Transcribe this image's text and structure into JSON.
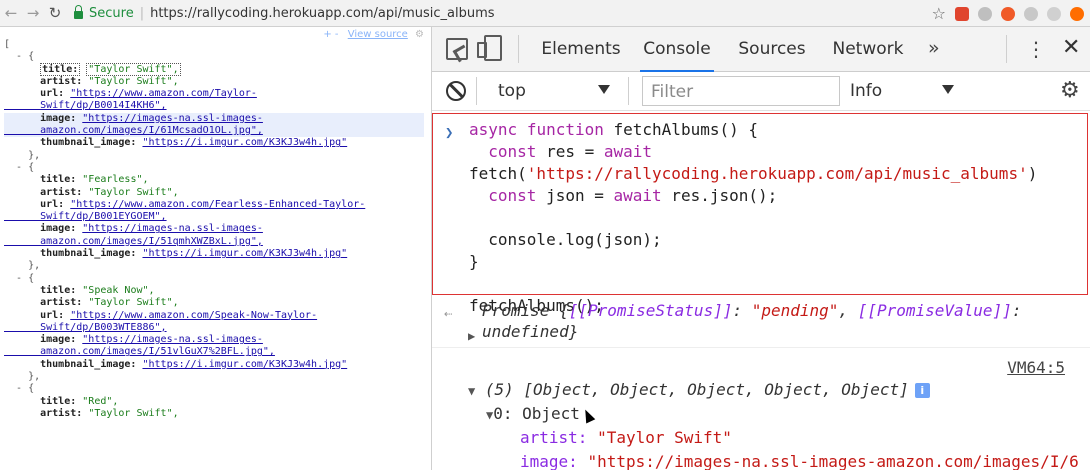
{
  "browser": {
    "secure_label": "Secure",
    "url": "https://rallycoding.herokuapp.com/api/music_albums"
  },
  "json_view": {
    "toolbar_plusminus": "+ -",
    "view_source": "View source",
    "lines": [
      "[",
      "  - {",
      "      title: \"Taylor Swift\",",
      "      artist: \"Taylor Swift\",",
      "      url: \"https://www.amazon.com/Taylor-",
      "      Swift/dp/B0014I4KH6\",",
      "      image: \"https://images-na.ssl-images-",
      "      amazon.com/images/I/61McsadO1OL.jpg\",",
      "      thumbnail_image: \"https://i.imgur.com/K3KJ3w4h.jpg\"",
      "    },",
      "  - {",
      "      title: \"Fearless\",",
      "      artist: \"Taylor Swift\",",
      "      url: \"https://www.amazon.com/Fearless-Enhanced-Taylor-",
      "      Swift/dp/B001EYGOEM\",",
      "      image: \"https://images-na.ssl-images-",
      "      amazon.com/images/I/51qmhXWZBxL.jpg\",",
      "      thumbnail_image: \"https://i.imgur.com/K3KJ3w4h.jpg\"",
      "    },",
      "  - {",
      "      title: \"Speak Now\",",
      "      artist: \"Taylor Swift\",",
      "      url: \"https://www.amazon.com/Speak-Now-Taylor-",
      "      Swift/dp/B003WTE886\",",
      "      image: \"https://images-na.ssl-images-",
      "      amazon.com/images/I/51vlGuX7%2BFL.jpg\",",
      "      thumbnail_image: \"https://i.imgur.com/K3KJ3w4h.jpg\"",
      "    },",
      "  - {",
      "      title: \"Red\",",
      "      artist: \"Taylor Swift\","
    ]
  },
  "devtools": {
    "tabs": [
      "Elements",
      "Console",
      "Sources",
      "Network"
    ],
    "active_tab": "Console",
    "more": "»",
    "context": "top",
    "filter_placeholder": "Filter",
    "level": "Info",
    "code_lines": [
      "async function fetchAlbums() {",
      "  const res = await",
      "fetch('https://rallycoding.herokuapp.com/api/music_albums')",
      "  const json = await res.json();",
      "",
      "  console.log(json);",
      "}",
      "",
      "fetchAlbums();"
    ],
    "promise_line1": "Promise {[[PromiseStatus]]: \"pending\", [[PromiseValue]]:",
    "promise_line2": "undefined}",
    "source_ref": "VM64:5",
    "array_summary": "(5) [Object, Object, Object, Object, Object]",
    "info_badge": "i",
    "item0": "0: Object",
    "prop_artist_key": "artist:",
    "prop_artist_val": "\"Taylor Swift\"",
    "prop_image_key": "image:",
    "prop_image_val": "\"https://images-na.ssl-images-amazon.com/images/I/6"
  }
}
